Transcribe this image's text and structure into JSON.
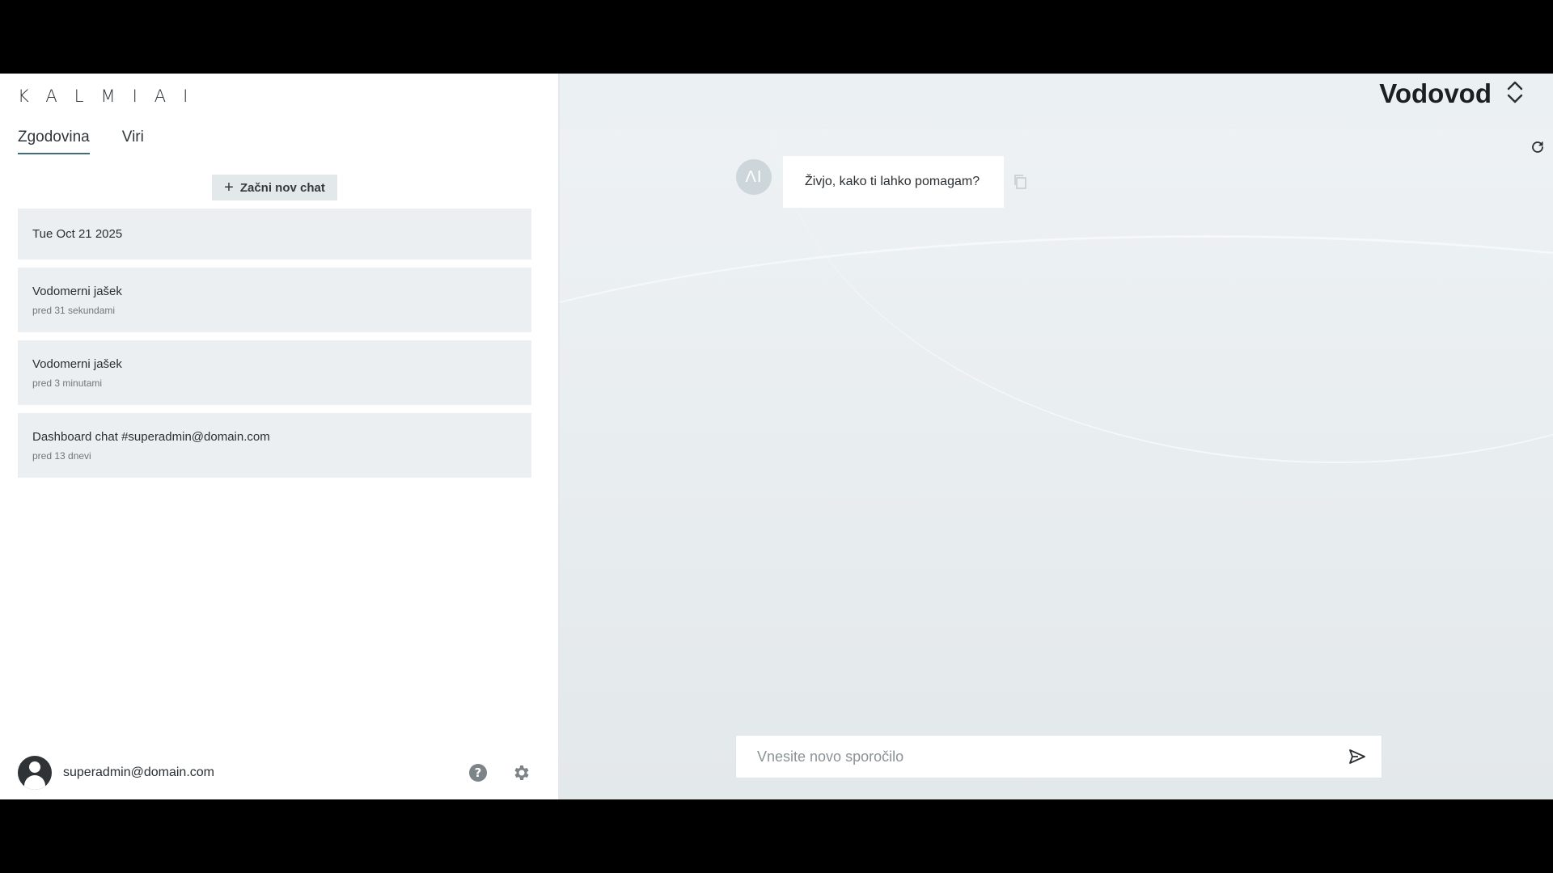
{
  "logo": "KALMIAI",
  "tabs": [
    {
      "label": "Zgodovina",
      "active": true
    },
    {
      "label": "Viri",
      "active": false
    }
  ],
  "new_chat_label": "Začni nov chat",
  "chat_list": {
    "date_header": "Tue Oct 21 2025",
    "items": [
      {
        "title": "Vodomerni jašek",
        "time": "pred 31 sekundami"
      },
      {
        "title": "Vodomerni jašek",
        "time": "pred 3 minutami"
      },
      {
        "title": "Dashboard chat #superadmin@domain.com",
        "time": "pred 13 dnevi"
      }
    ]
  },
  "user": {
    "email": "superadmin@domain.com"
  },
  "icons": {
    "help": "help-icon",
    "settings": "gear-icon",
    "refresh": "refresh-icon",
    "copy": "copy-icon",
    "send": "send-icon",
    "workspace_toggle": "chevron-up-down-icon"
  },
  "workspace": {
    "name": "Vodovod"
  },
  "messages": [
    {
      "sender": "AI",
      "avatar_text": "ΛI",
      "text": "Živjo, kako ti lahko pomagam?"
    }
  ],
  "composer": {
    "placeholder": "Vnesite novo sporočilo",
    "value": ""
  },
  "colors": {
    "tab_underline": "#3f6d7a",
    "card_bg": "#ebeff1",
    "main_bg": "#e8edf0"
  }
}
